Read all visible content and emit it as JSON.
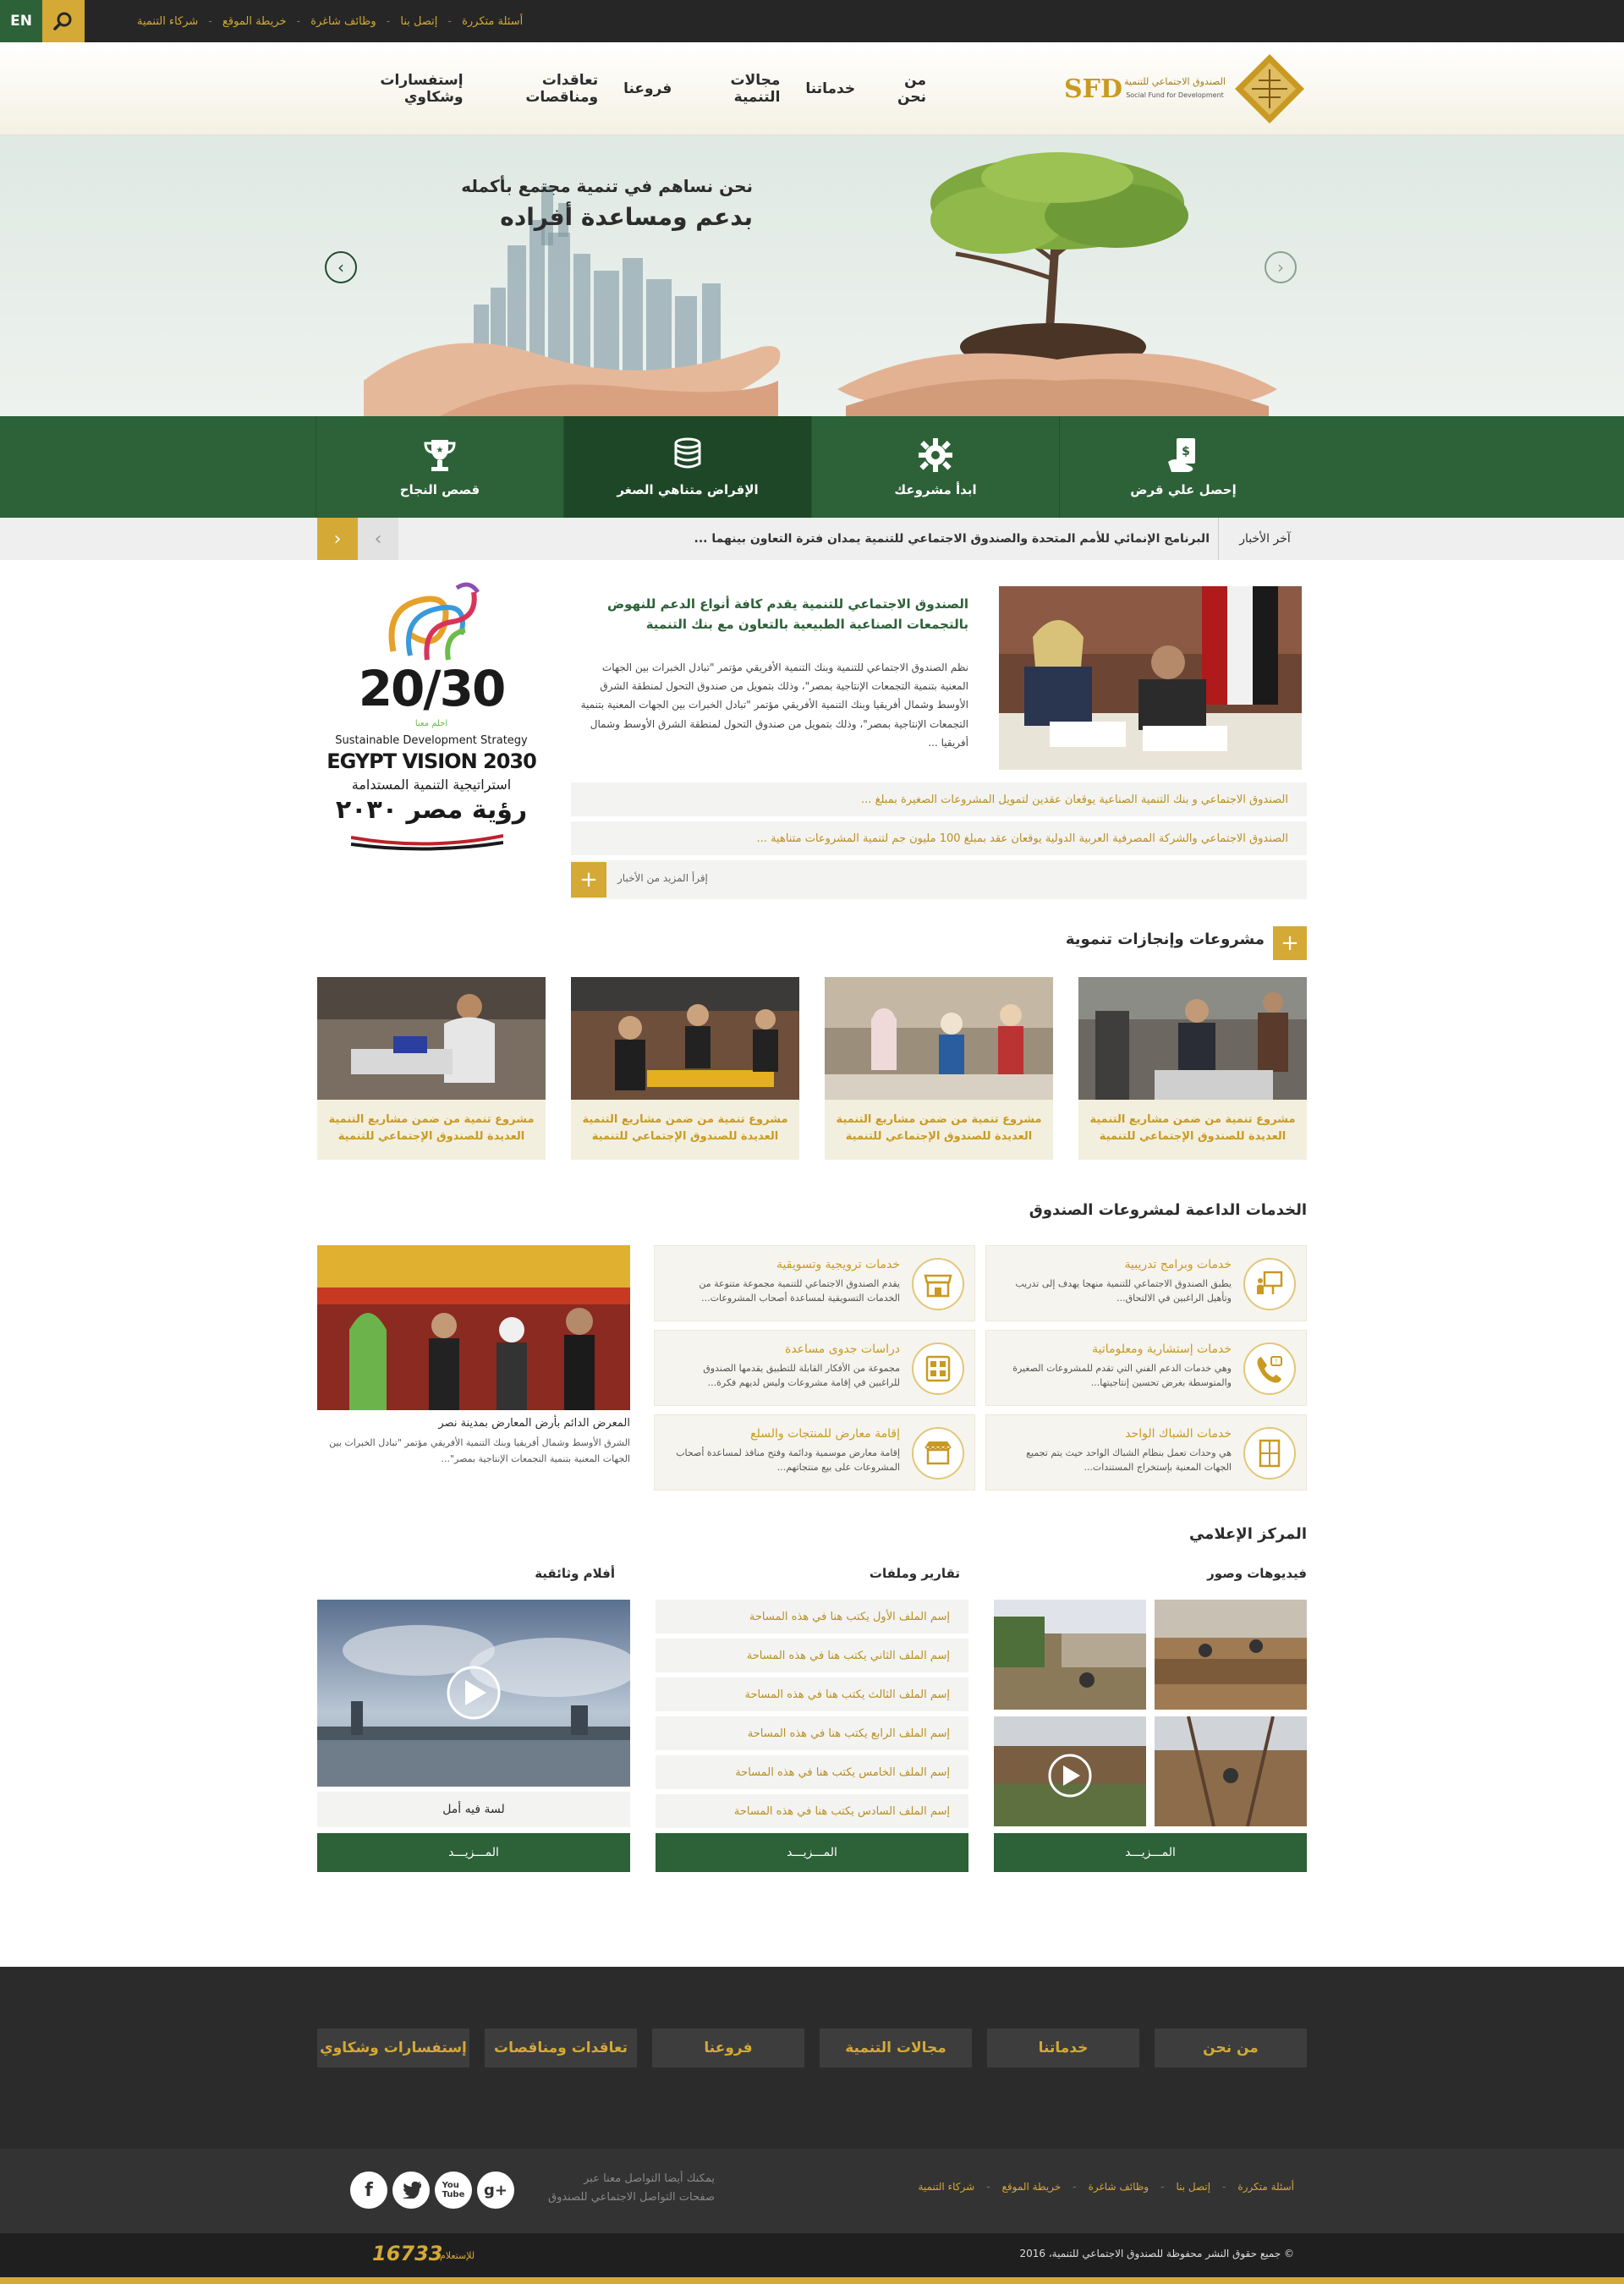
{
  "topbar": {
    "lang": "EN",
    "links": [
      "أسئلة متكررة",
      "إتصل بنا",
      "وظائف شاغرة",
      "خريطة الموقع",
      "شركاء التنمية"
    ]
  },
  "logo": {
    "mark": "SFD",
    "arabic": "الصندوق الاجتماعي للتنمية",
    "english": "Social Fund for Development"
  },
  "nav": [
    "من نحن",
    "خدماتنا",
    "مجالات التنمية",
    "فروعنا",
    "تعاقدات ومناقصات",
    "إستفسارات وشكاوي"
  ],
  "hero": {
    "line1": "نحن نساهم في تنمية مجتمع بأكمله",
    "line2": "بدعم ومساعدة أفراده"
  },
  "service_tiles": [
    "إحصل علي قرض",
    "ابدأ مشروعك",
    "الإقراض متناهي الصغر",
    "قصص النجاح"
  ],
  "ticker": {
    "label": "آخر الأخبار",
    "text": "البرنامج الإنمائي للأمم المتحدة والصندوق الاجتماعي للتنمية يمدان فترة التعاون بينهما ..."
  },
  "feature": {
    "title": "الصندوق الاجتماعي للتنمية يقدم كافة أنواع الدعم للنهوض بالتجمعات الصناعية الطبيعية بالتعاون مع بنك التنمية",
    "body": "نظم الصندوق الاجتماعي للتنمية وبنك التنمية الأفريقي مؤتمر \"تبادل الخبرات بين الجهات المعنية بتنمية التجمعات الإنتاجية بمصر\"، وذلك بتمويل من صندوق التحول لمنطقة الشرق الأوسط وشمال أفريقيا وبنك التنمية الأفريقي مؤتمر \"تبادل الخبرات بين الجهات المعنية بتنمية التجمعات الإنتاجية بمصر\"، وذلك بتمويل من صندوق التحول لمنطقة الشرق الأوسط وشمال أفريقيا ..."
  },
  "news_items": [
    "الصندوق الاجتماعي و بنك التنمية الصناعية يوقعان عقدين لتمويل المشروعات الصغيرة بمبلغ ...",
    "الصندوق الاجتماعي والشركة المصرفية العربية الدولية يوقعان عقد بمبلغ 100 مليون جم لتنمية المشروعات متناهية ..."
  ],
  "more_news": "إقرأ المزيد من الأخبار",
  "vision": {
    "year": "20/30",
    "sub": "احلم معنا",
    "en1": "Sustainable Development Strategy",
    "en2": "EGYPT VISION 2030",
    "ar1": "استراتيجية التنمية المستدامة",
    "ar2": "رؤية مصر ٢٠٣٠"
  },
  "projects": {
    "title": "مشروعات وإنجازات تنموية",
    "cards": [
      "مشروع تنمية من ضمن مشاريع التنمية العديدة للصندوق الإجتماعي للتنمية",
      "مشروع تنمية من ضمن مشاريع التنمية العديدة للصندوق الإجتماعي للتنمية",
      "مشروع تنمية من ضمن مشاريع التنمية العديدة للصندوق الإجتماعي للتنمية",
      "مشروع تنمية من ضمن مشاريع التنمية العديدة للصندوق الإجتماعي للتنمية"
    ]
  },
  "services": {
    "title": "الخدمات الداعمة لمشروعات الصندوق",
    "items": [
      {
        "h": "خدمات وبرامج تدريبية",
        "d": "يطبق الصندوق الاجتماعي للتنمية منهجا يهدف إلى تدريب وتأهيل الراغبين في الالتحاق..."
      },
      {
        "h": "خدمات ترويجية وتسويقية",
        "d": "يقدم الصندوق الاجتماعي للتنمية مجموعة متنوعة من الخدمات التسويقية لمساعدة أصحاب المشروعات..."
      },
      {
        "h": "خدمات إستشارية ومعلوماتية",
        "d": "وهي خدمات الدعم الفني التي تقدم للمشروعات الصغيرة والمتوسطة بغرض تحسين إنتاجيتها..."
      },
      {
        "h": "دراسات جدوى مساعدة",
        "d": "مجموعة من الأفكار القابلة للتطبيق يقدمها الصندوق للراغبين في إقامة مشروعات وليس لديهم فكرة..."
      },
      {
        "h": "خدمات الشباك الواحد",
        "d": "هي وحدات تعمل بنظام الشباك الواحد حيث يتم تجميع الجهات المعنية بإستخراج المستندات..."
      },
      {
        "h": "إقامة معارض للمنتجات والسلع",
        "d": "إقامة معارض موسمية ودائمة وفتح منافذ لمساعدة أصحاب المشروعات على بيع منتجاتهم..."
      }
    ],
    "exhibit_title": "المعرض الدائم بأرض المعارض بمدينة نصر",
    "exhibit_text": "الشرق الأوسط وشمال أفريقيا وبنك التنمية الأفريقي مؤتمر \"تبادل الخبرات بين الجهات المعنية بتنمية التجمعات الإنتاجية بمصر\"..."
  },
  "media": {
    "title": "المركز الإعلامي",
    "videos_title": "فيديوهات وصور",
    "files_title": "تقارير وملفات",
    "films_title": "أفلام وثائقية",
    "files": [
      "إسم الملف الأول يكتب هنا في هذه المساحة",
      "إسم الملف الثاني يكتب هنا في هذه المساحة",
      "إسم الملف الثالث يكتب هنا في هذه المساحة",
      "إسم الملف الرابع يكتب هنا في هذه المساحة",
      "إسم الملف الخامس يكتب هنا في هذه المساحة",
      "إسم الملف السادس يكتب هنا في هذه المساحة"
    ],
    "film_caption": "لسة فيه أمل",
    "more": "المـــزيـــد"
  },
  "footer": {
    "nav": [
      "من نحن",
      "خدماتنا",
      "مجالات التنمية",
      "فروعنا",
      "تعاقدات ومناقصات",
      "إستفسارات وشكاوي"
    ],
    "links": [
      "أسئلة متكررة",
      "إتصل بنا",
      "وظائف شاغرة",
      "خريطة الموقع",
      "شركاء التنمية"
    ],
    "social_text1": "يمكنك أيضا التواصل معنا عبر",
    "social_text2": "صفحات التواصل الاجتماعي للصندوق",
    "copyright": "© جميع حقوق النشر محفوظة للصندوق الاجتماعي للتنمية، 2016",
    "hotline_label": "للإستعلام",
    "hotline": "16733"
  },
  "colors": {
    "green": "#2d6138",
    "gold": "#d4a935",
    "dark": "#262626"
  }
}
